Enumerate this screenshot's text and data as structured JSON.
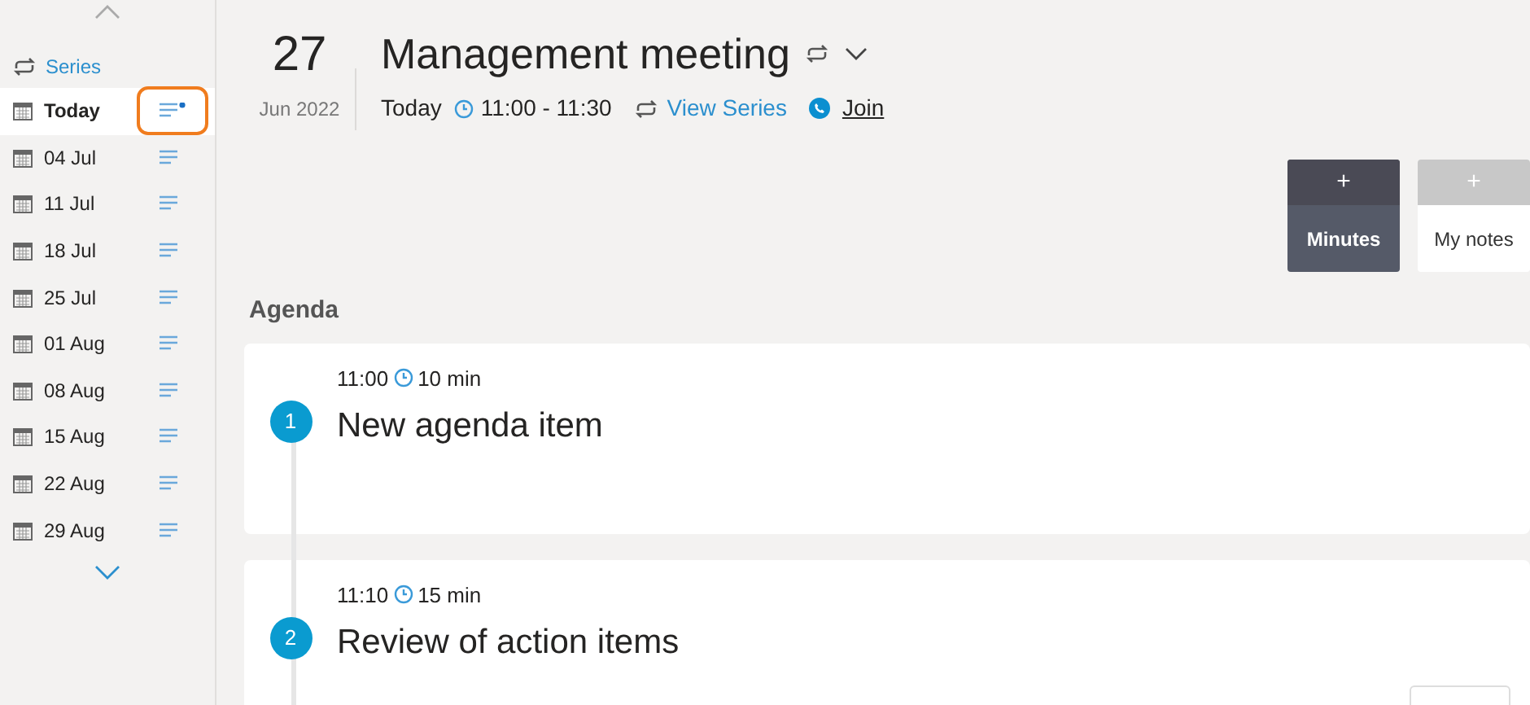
{
  "sidebar": {
    "series_link": "Series",
    "items": [
      {
        "label": "Today",
        "selected": true,
        "unread": true,
        "highlighted": true
      },
      {
        "label": "04 Jul",
        "selected": false,
        "unread": false,
        "highlighted": false
      },
      {
        "label": "11 Jul",
        "selected": false,
        "unread": false,
        "highlighted": false
      },
      {
        "label": "18 Jul",
        "selected": false,
        "unread": false,
        "highlighted": false
      },
      {
        "label": "25 Jul",
        "selected": false,
        "unread": false,
        "highlighted": false
      },
      {
        "label": "01 Aug",
        "selected": false,
        "unread": false,
        "highlighted": false
      },
      {
        "label": "08 Aug",
        "selected": false,
        "unread": false,
        "highlighted": false
      },
      {
        "label": "15 Aug",
        "selected": false,
        "unread": false,
        "highlighted": false
      },
      {
        "label": "22 Aug",
        "selected": false,
        "unread": false,
        "highlighted": false
      },
      {
        "label": "29 Aug",
        "selected": false,
        "unread": false,
        "highlighted": false
      }
    ]
  },
  "header": {
    "day": "27",
    "month_year": "Jun 2022",
    "title": "Management meeting",
    "when": "Today",
    "time": "11:00 - 11:30",
    "view_series": "View Series",
    "join": "Join"
  },
  "tabs": [
    {
      "plus": "+",
      "label": "Minutes",
      "selected": true
    },
    {
      "plus": "+",
      "label": "My notes",
      "selected": false
    }
  ],
  "agenda": {
    "heading": "Agenda",
    "items": [
      {
        "number": "1",
        "start": "11:00",
        "duration": "10 min",
        "title": "New agenda item"
      },
      {
        "number": "2",
        "start": "11:10",
        "duration": "15 min",
        "title": "Review of action items"
      }
    ]
  }
}
